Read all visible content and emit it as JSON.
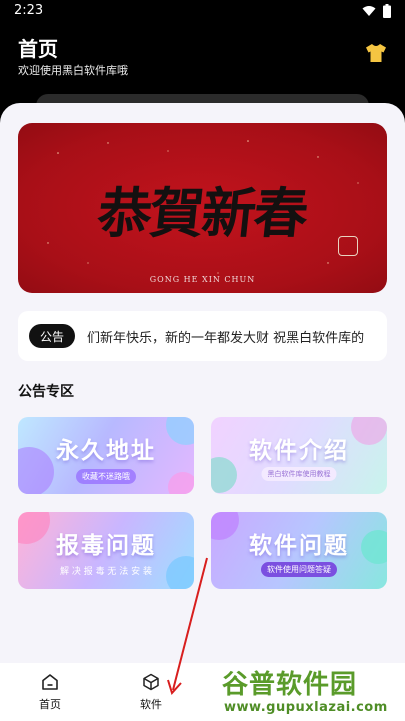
{
  "status": {
    "time": "2:23"
  },
  "header": {
    "title": "首页",
    "subtitle": "欢迎使用黑白软件库哦",
    "theme_icon": "shirt-icon"
  },
  "banner": {
    "title": "恭賀新春",
    "caption": "GONG HE XIN CHUN",
    "background": "#b0121a"
  },
  "notice": {
    "badge": "公告",
    "text": "们新年快乐，新的一年都发大财  祝黑白软件库的"
  },
  "section": {
    "title": "公告专区"
  },
  "tiles": [
    {
      "title": "永久地址",
      "subtitle": "收藏不迷路哦"
    },
    {
      "title": "软件介绍",
      "subtitle": "黑白软件库使用教程"
    },
    {
      "title": "报毒问题",
      "subtitle": "解 决 报 毒 无 法 安 装"
    },
    {
      "title": "软件问题",
      "subtitle": "软件使用问题答疑"
    }
  ],
  "nav": {
    "items": [
      {
        "label": "首页",
        "icon": "home-icon"
      },
      {
        "label": "软件",
        "icon": "box-icon"
      }
    ]
  },
  "watermark": {
    "brand": "谷普软件园",
    "url": "www.gupuxlazai.com"
  }
}
